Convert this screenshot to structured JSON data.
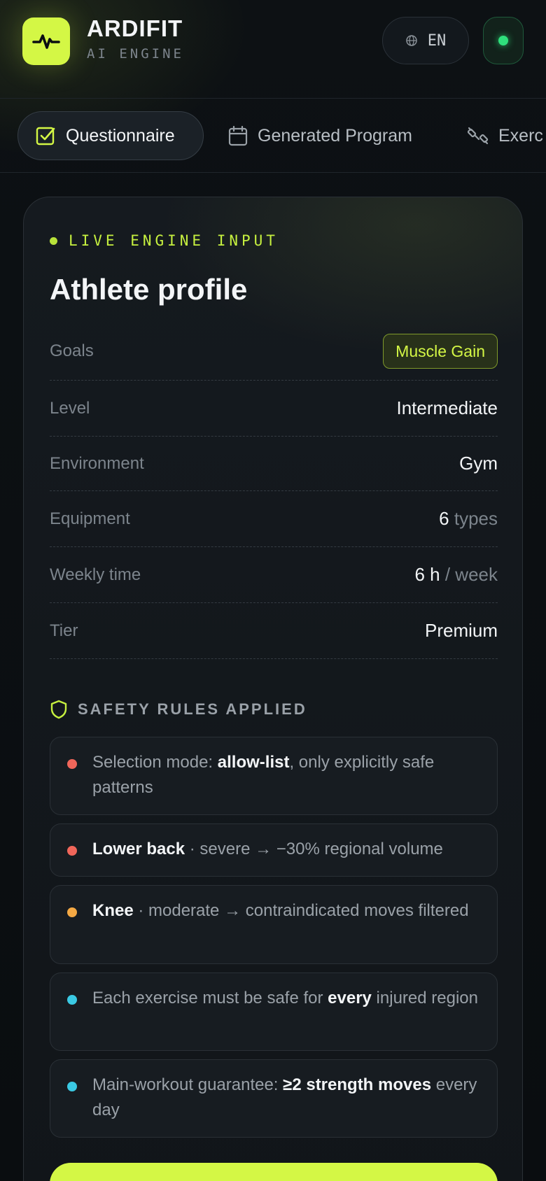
{
  "header": {
    "brand_name": "ARDIFIT",
    "brand_sub": "AI ENGINE",
    "lang_label": "EN"
  },
  "tabs": [
    {
      "label": "Questionnaire",
      "active": true,
      "icon": "checkbox-icon"
    },
    {
      "label": "Generated Program",
      "active": false,
      "icon": "calendar-icon"
    },
    {
      "label": "Exerc",
      "active": false,
      "icon": "dumbbell-icon"
    }
  ],
  "card": {
    "live_label": "LIVE ENGINE INPUT",
    "title": "Athlete profile",
    "rows": [
      {
        "label": "Goals",
        "value": "Muscle Gain"
      },
      {
        "label": "Level",
        "value": "Intermediate"
      },
      {
        "label": "Environment",
        "value": "Gym"
      },
      {
        "label": "Equipment",
        "value": "6",
        "unit": "types"
      },
      {
        "label": "Weekly time",
        "value": "6 h",
        "unit": "/ week"
      },
      {
        "label": "Tier",
        "value": "Premium"
      }
    ],
    "safety_title": "SAFETY RULES APPLIED",
    "rules": [
      {
        "dot_color": "#f0665a",
        "p1": "Selection mode: ",
        "b1": "allow-list",
        "p2": ", only explicitly safe patterns",
        "b2": "",
        "p3": ""
      },
      {
        "dot_color": "#f0665a",
        "p1": "",
        "b1": "Lower back",
        "p2": " · severe → −30% regional volume",
        "b2": "",
        "p3": ""
      },
      {
        "dot_color": "#f5a944",
        "p1": "",
        "b1": "Knee",
        "p2": " · moderate → contraindicated moves filtered",
        "b2": "",
        "p3": ""
      },
      {
        "dot_color": "#3ac9e3",
        "p1": "Each exercise must be safe for ",
        "b1": "every",
        "p2": " injured region",
        "b2": "",
        "p3": ""
      },
      {
        "dot_color": "#3ac9e3",
        "p1": "Main-workout guarantee: ",
        "b1": "≥2 strength moves",
        "p2": " every day",
        "b2": "",
        "p3": ""
      }
    ]
  },
  "colors": {
    "accent": "#d4f745",
    "status_green": "#2fe07c"
  }
}
